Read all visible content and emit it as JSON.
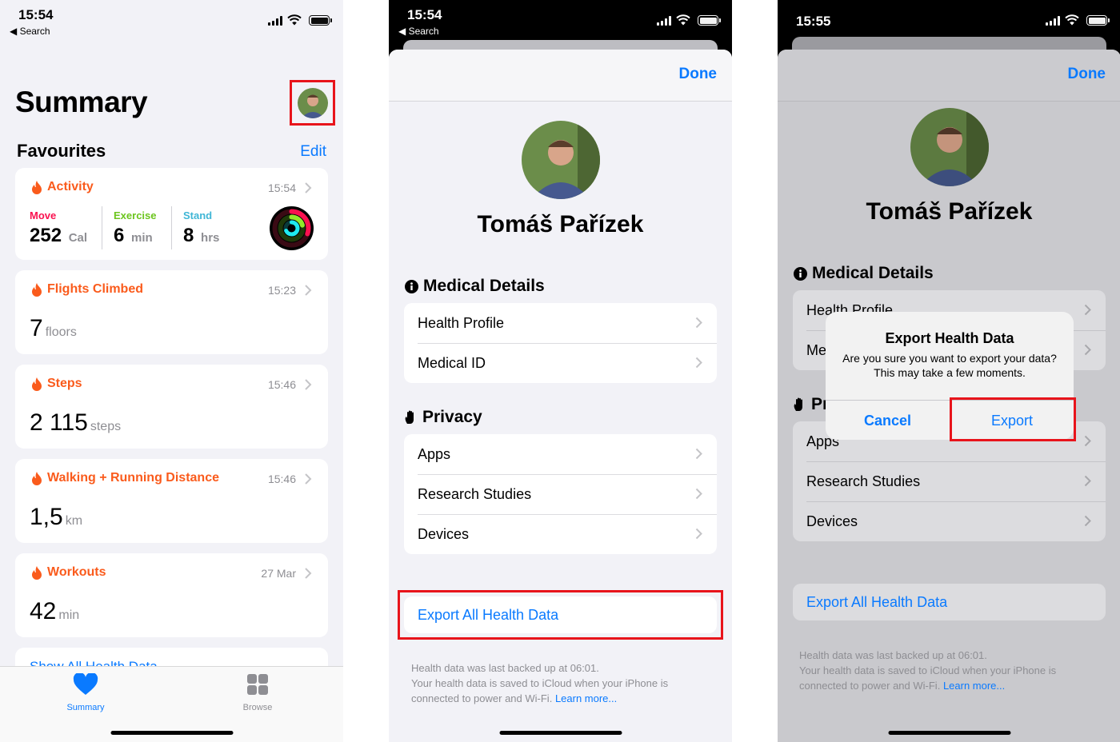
{
  "status_bar": [
    {
      "time": "15:54",
      "back_label": "◀ Search"
    },
    {
      "time": "15:54",
      "back_label": "◀ Search"
    },
    {
      "time": "15:55"
    }
  ],
  "summary": {
    "title": "Summary",
    "favourites_label": "Favourites",
    "edit_label": "Edit",
    "activity": {
      "title": "Activity",
      "time": "15:54",
      "move": {
        "label": "Move",
        "value": "252",
        "unit": "Cal",
        "color": "#fa114f"
      },
      "exercise": {
        "label": "Exercise",
        "value": "6",
        "unit": "min",
        "color": "#92e82a"
      },
      "stand": {
        "label": "Stand",
        "value": "8",
        "unit": "hrs",
        "color": "#1eeaef"
      }
    },
    "flights": {
      "title": "Flights Climbed",
      "time": "15:23",
      "value": "7",
      "unit": "floors"
    },
    "steps": {
      "title": "Steps",
      "time": "15:46",
      "value": "2 115",
      "unit": "steps"
    },
    "distance": {
      "title": "Walking + Running Distance",
      "time": "15:46",
      "value": "1,5",
      "unit": "km"
    },
    "workouts": {
      "title": "Workouts",
      "time": "27 Mar",
      "value": "42",
      "unit": "min"
    },
    "show_all": "Show All Health Data",
    "tabs": {
      "summary": "Summary",
      "browse": "Browse"
    }
  },
  "profile": {
    "done_label": "Done",
    "name": "Tomáš Pařízek",
    "medical_header": "Medical Details",
    "medical_items": [
      "Health Profile",
      "Medical ID"
    ],
    "medical_items_obscured": [
      "Health Profile",
      "Me"
    ],
    "privacy_header": "Privacy",
    "privacy_header_obscured": "Pr",
    "privacy_items": [
      "Apps",
      "Research Studies",
      "Devices"
    ],
    "export_label": "Export All Health Data",
    "footnote_line1": "Health data was last backed up at 06:01.",
    "footnote_line2": "Your health data is saved to iCloud when your iPhone is connected to power and Wi-Fi.",
    "learn_more": "Learn more..."
  },
  "alert": {
    "title": "Export Health Data",
    "message": "Are you sure you want to export your data? This may take a few moments.",
    "cancel": "Cancel",
    "export": "Export"
  },
  "colors": {
    "accent": "#0a7aff",
    "activity_orange": "#fa5b1c",
    "highlight_red": "#e8141b"
  }
}
